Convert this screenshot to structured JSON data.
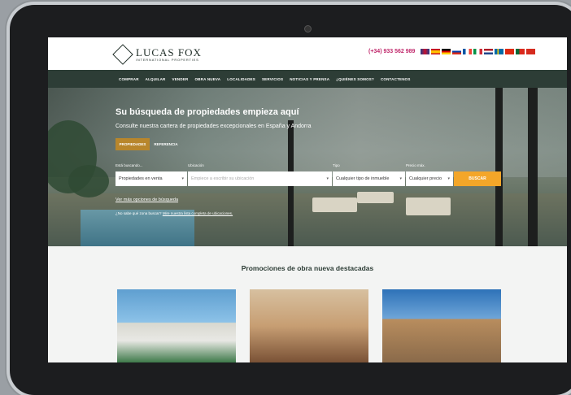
{
  "brand": {
    "name": "LUCAS FOX",
    "tagline": "INTERNATIONAL PROPERTIES",
    "accent": "#c0296c",
    "nav_bg": "#2d3d36",
    "button_color": "#f3a629",
    "tab_color": "#b8862c"
  },
  "header": {
    "phone": "(+34) 933 562 989",
    "flags": [
      "uk",
      "es",
      "de",
      "ru",
      "fr",
      "it",
      "nl",
      "se",
      "cn",
      "pt",
      "ch"
    ]
  },
  "nav": {
    "items": [
      "COMPRAR",
      "ALQUILAR",
      "VENDER",
      "OBRA NUEVA",
      "LOCALIDADES",
      "SERVICIOS",
      "NOTICIAS Y PRENSA",
      "¿QUIÉNES SOMOS?",
      "CONTACTENOS"
    ]
  },
  "hero": {
    "title": "Su búsqueda de propiedades empieza aquí",
    "subtitle": "Consulte nuestra cartera de propiedades excepcionales en España y Andorra",
    "tabs": [
      "PROPIEDADES",
      "REFERENCIA"
    ],
    "labels": {
      "searching": "Está buscando...",
      "location": "Ubicación",
      "type": "Tipo",
      "max_price": "Precio máx."
    },
    "fields": {
      "searching": "Propiedades en venta",
      "location_placeholder": "Empiece a escribir su ubicación",
      "type": "Cualquier tipo de inmueble",
      "max_price": "Cualquier precio"
    },
    "search_button": "BUSCAR",
    "more_options": "Ver más opciones de búsqueda",
    "help_text": "¿No sabe qué zona buscar?",
    "help_link": "Mire nuestra lista completa de ubicaciones."
  },
  "promos": {
    "heading": "Promociones de obra nueva destacadas"
  }
}
